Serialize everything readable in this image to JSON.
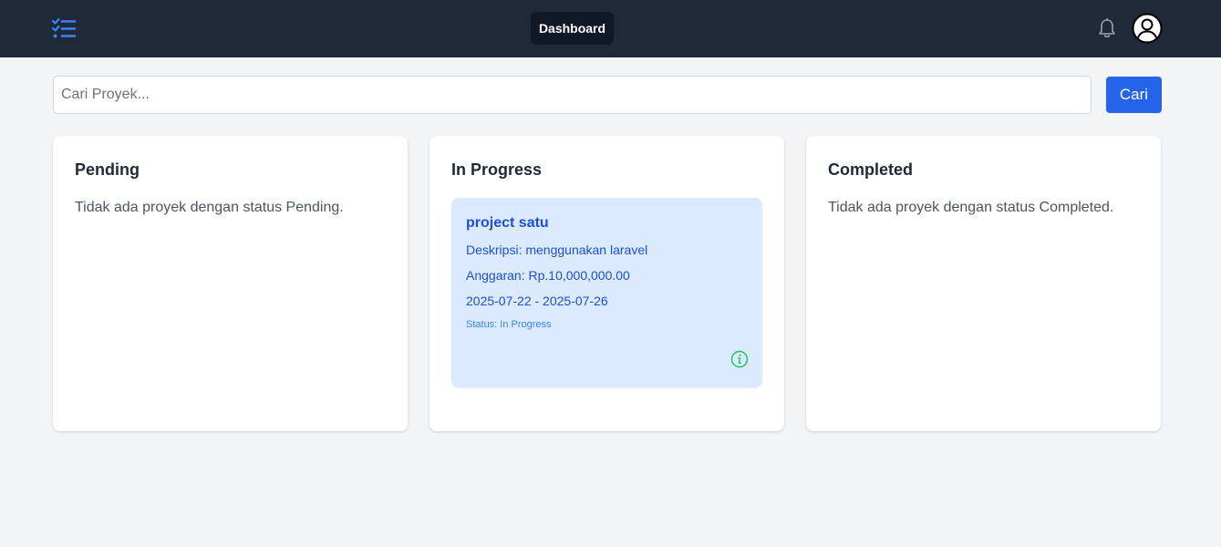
{
  "nav": {
    "tab_label": "Dashboard",
    "logo_icon": "checklist-icon",
    "bell_icon": "bell-icon",
    "avatar_icon": "user-circle-icon"
  },
  "search": {
    "placeholder": "Cari Proyek...",
    "value": "",
    "button_label": "Cari"
  },
  "columns": [
    {
      "title": "Pending",
      "empty_text": "Tidak ada proyek dengan status Pending."
    },
    {
      "title": "In Progress",
      "projects": [
        {
          "name": "project satu",
          "description": "Deskripsi: menggunakan laravel",
          "budget": "Anggaran: Rp.10,000,000.00",
          "dates": "2025-07-22 - 2025-07-26",
          "status": "Status: In Progress",
          "info_icon": "info-circle-icon"
        }
      ]
    },
    {
      "title": "Completed",
      "empty_text": "Tidak ada proyek dengan status Completed."
    }
  ],
  "colors": {
    "navbar": "#1f2937",
    "accent": "#2563eb",
    "card_highlight": "#dbeafe",
    "info_icon": "#22c55e"
  }
}
